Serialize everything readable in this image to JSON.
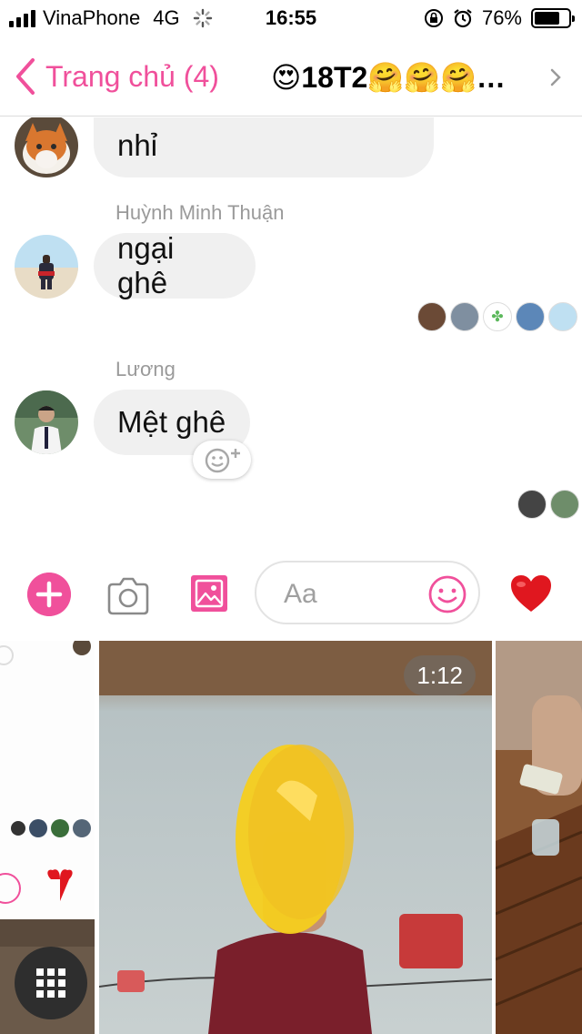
{
  "status_bar": {
    "carrier": "VinaPhone",
    "network": "4G",
    "time": "16:55",
    "battery_text": "76%",
    "battery_level": 0.76
  },
  "nav": {
    "back_label": "Trang chủ (4)",
    "title": "😍18T2🤗🤗🤗…"
  },
  "messages": [
    {
      "sender": "",
      "text": "nhỉ"
    },
    {
      "sender": "Huỳnh Minh Thuận",
      "text": "ngại ghê"
    },
    {
      "sender": "Lương",
      "text": "Mệt ghê"
    }
  ],
  "composer": {
    "placeholder": "Aa"
  },
  "media": {
    "video_duration": "1:12"
  },
  "icons": {
    "accent": "#f0509b",
    "heart": "heart-icon",
    "plus": "plus-icon",
    "camera": "camera-icon",
    "gallery": "gallery-icon",
    "emoji": "emoji-icon"
  }
}
